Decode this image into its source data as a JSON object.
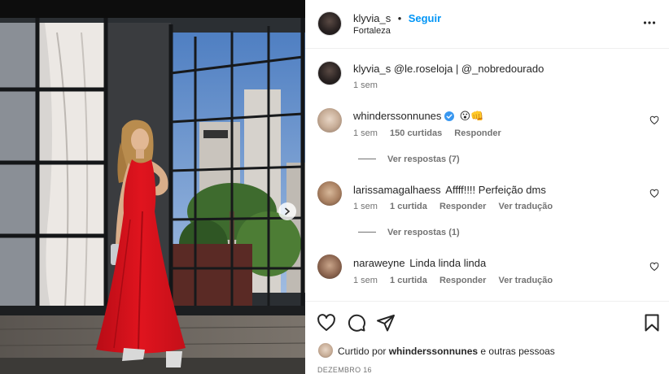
{
  "post": {
    "owner": "klyvia_s",
    "separator": "•",
    "follow_label": "Seguir",
    "location": "Fortaleza",
    "caption_user": "klyvia_s",
    "caption_text": "@le.roseloja | @_nobredourado",
    "caption_time": "1 sem",
    "date": "DEZEMBRO 16"
  },
  "comments": [
    {
      "user": "whinderssonnunes",
      "verified": true,
      "text": "😮👊",
      "time": "1 sem",
      "likes": "150 curtidas",
      "reply_label": "Responder",
      "view_replies": "Ver respostas (7)"
    },
    {
      "user": "larissamagalhaess",
      "text": "Affff!!!! Perfeição dms",
      "time": "1 sem",
      "likes": "1 curtida",
      "reply_label": "Responder",
      "translate_label": "Ver tradução",
      "view_replies": "Ver respostas (1)"
    },
    {
      "user": "naraweyne",
      "text": "Linda linda linda",
      "time": "1 sem",
      "likes": "1 curtida",
      "reply_label": "Responder",
      "translate_label": "Ver tradução"
    }
  ],
  "liked_by": {
    "prefix": "Curtido por",
    "user": "whinderssonnunes",
    "suffix": "e outras pessoas"
  },
  "colors": {
    "accent": "#0095f6",
    "verified": "#3897f0",
    "dress": "#e0141e"
  },
  "icons": [
    "more-icon",
    "verified-icon",
    "heart-icon",
    "comment-icon",
    "share-icon",
    "bookmark-icon",
    "chevron-right-icon"
  ]
}
